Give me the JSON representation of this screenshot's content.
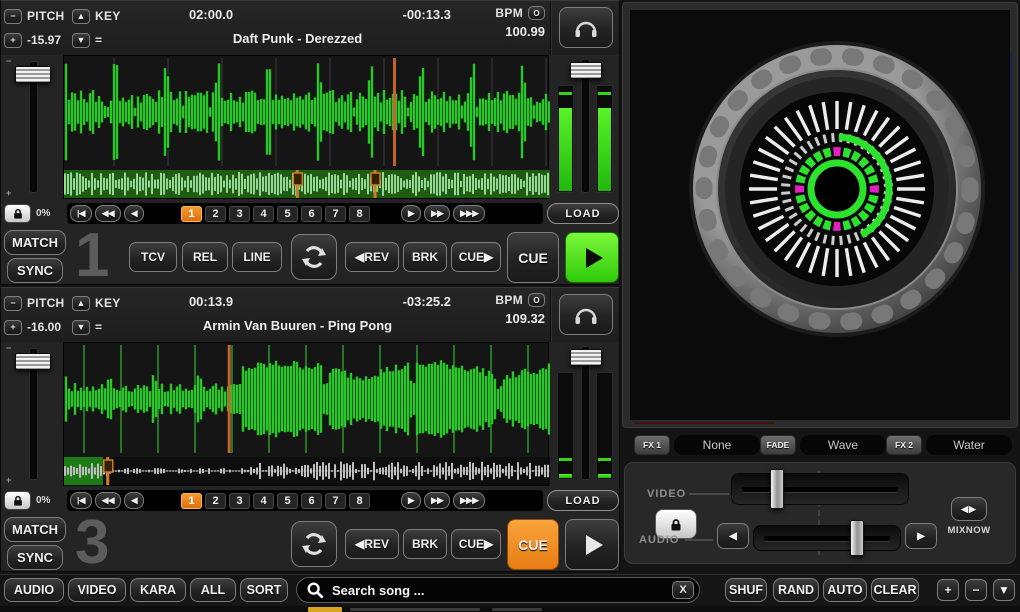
{
  "decks": [
    {
      "number": "1",
      "pitch_minus": "−",
      "pitch_plus": "+",
      "pitch_label": "PITCH",
      "pitch_value": "-15.97",
      "key_up": "▲",
      "key_down": "▼",
      "key_label": "KEY",
      "key_value": "=",
      "time_elapsed": "02:00.0",
      "time_remaining": "-00:13.3",
      "bpm_label": "BPM",
      "bpm_btn": "O",
      "bpm_value": "100.99",
      "title": "Daft Punk - Derezzed",
      "lock_pct": "0%",
      "match": "MATCH",
      "sync": "SYNC",
      "nav_prev": "|◀",
      "nav_rew": "◀◀",
      "nav_back": "◀",
      "nav_fwd": "▶",
      "nav_ffwd": "▶▶",
      "nav_fffwd": "▶▶▶",
      "hotcues": [
        "1",
        "2",
        "3",
        "4",
        "5",
        "6",
        "7",
        "8"
      ],
      "load": "LOAD",
      "mode_tcv": "TCV",
      "mode_rel": "REL",
      "mode_line": "LINE",
      "rev": "◀REV",
      "brk": "BRK",
      "cue_step": "CUE▶",
      "cue": "CUE",
      "state": {
        "active_hotcue": 0,
        "playing": true,
        "cue_active": false,
        "playhead_pct": 68,
        "overview_markers": [
          48,
          64
        ],
        "overview_played_pct": 0,
        "meter_pct": 78,
        "pitch_slider_pct": 5,
        "vol_slider_pct": 3
      }
    },
    {
      "number": "3",
      "pitch_minus": "−",
      "pitch_plus": "+",
      "pitch_label": "PITCH",
      "pitch_value": "-16.00",
      "key_up": "▲",
      "key_down": "▼",
      "key_label": "KEY",
      "key_value": "=",
      "time_elapsed": "00:13.9",
      "time_remaining": "-03:25.2",
      "bpm_label": "BPM",
      "bpm_btn": "O",
      "bpm_value": "109.32",
      "title": "Armin Van Buuren - Ping Pong",
      "lock_pct": "0%",
      "match": "MATCH",
      "sync": "SYNC",
      "nav_prev": "|◀",
      "nav_rew": "◀◀",
      "nav_back": "◀",
      "nav_fwd": "▶",
      "nav_ffwd": "▶▶",
      "nav_fffwd": "▶▶▶",
      "hotcues": [
        "1",
        "2",
        "3",
        "4",
        "5",
        "6",
        "7",
        "8"
      ],
      "load": "LOAD",
      "rev": "◀REV",
      "brk": "BRK",
      "cue_step": "CUE▶",
      "cue": "CUE",
      "state": {
        "active_hotcue": 0,
        "playing": false,
        "cue_active": true,
        "playhead_pct": 34,
        "overview_markers": [
          9
        ],
        "overview_played_pct": 8,
        "meter_pct": 4,
        "pitch_slider_pct": 5,
        "vol_slider_pct": 3
      }
    }
  ],
  "fx": {
    "fx1_label": "FX 1",
    "fx1_value": "None",
    "fade_label": "FADE",
    "fade_value": "Wave",
    "fx2_label": "FX 2",
    "fx2_value": "Water"
  },
  "mixer": {
    "video_label": "VIDEO",
    "audio_label": "AUDIO",
    "audio_left": "◀",
    "audio_right": "▶",
    "mixnow_icon": "◀▶",
    "mixnow_label": "MIXNOW",
    "video_slider_pct": 25,
    "audio_slider_pct": 70
  },
  "browser": {
    "filters": [
      "AUDIO",
      "VIDEO",
      "KARA",
      "ALL",
      "SORT"
    ],
    "search_placeholder": "Search song ...",
    "clear_button": "X",
    "controls": [
      "SHUF",
      "RAND",
      "AUTO",
      "CLEAR"
    ],
    "plus": "+",
    "minus": "−",
    "dropdown": "▼"
  },
  "colors": {
    "wave_green": "#28c828",
    "playhead_orange": "#c8622d",
    "hotcue_orange": "#e8821a",
    "play_green": "#35d615",
    "jog_magenta": "#e020c0"
  }
}
